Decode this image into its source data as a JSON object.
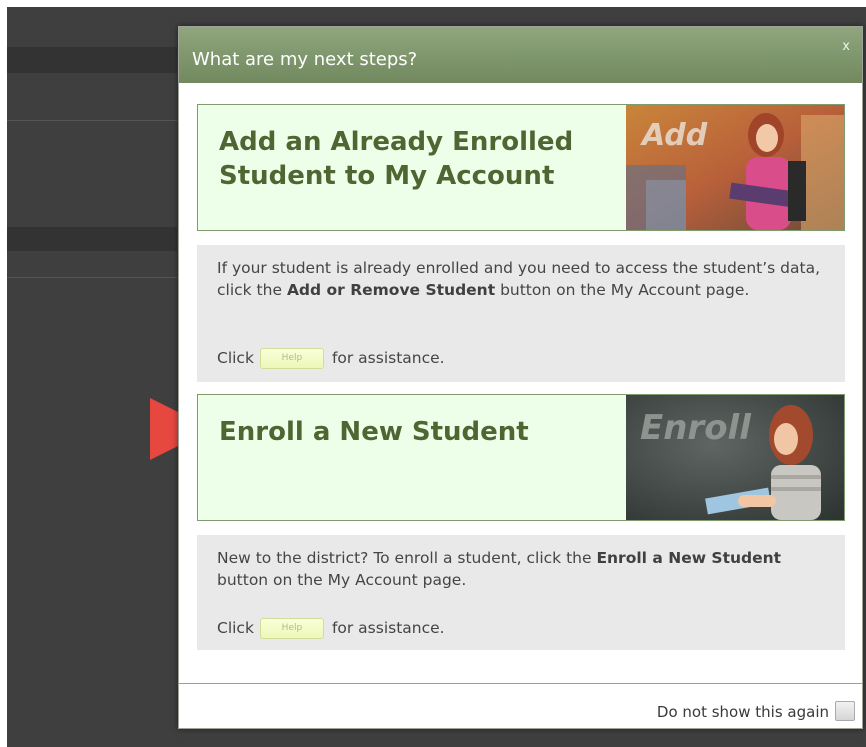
{
  "dialog": {
    "title": "What are my next steps?",
    "close_label": "x",
    "dont_show_label": "Do not show this again"
  },
  "cards": [
    {
      "title_line1": "Add an Already Enrolled",
      "title_line2": "Student to My Account",
      "photo_word": "Add",
      "desc_pre": "If your student is already enrolled and you need to access the student’s data, click the ",
      "desc_bold": "Add or Remove Student",
      "desc_post": " button on the My Account page.",
      "click_label": "Click",
      "help_label": "Help",
      "assist_label": "for assistance."
    },
    {
      "title_line1": "Enroll a New Student",
      "photo_word": "Enroll",
      "desc_pre": "New to the district? To enroll a student, click the ",
      "desc_bold": "Enroll a New Student",
      "desc_post": " button on the My Account page.",
      "click_label": "Click",
      "help_label": "Help",
      "assist_label": "for assistance."
    }
  ],
  "colors": {
    "header": "#7f9770",
    "card_bg": "#eeffe9",
    "card_title": "#4f6633",
    "arrow": "#e6483f"
  }
}
